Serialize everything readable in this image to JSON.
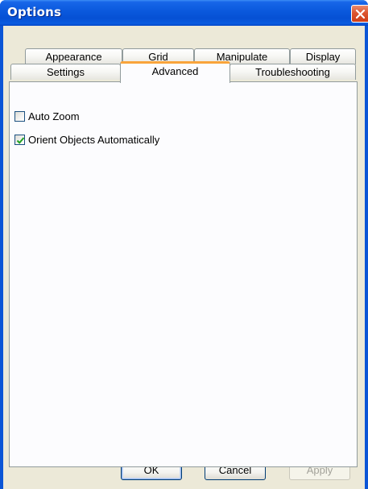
{
  "window": {
    "title": "Options"
  },
  "tabs": {
    "row1": [
      "Appearance",
      "Grid",
      "Manipulate",
      "Display"
    ],
    "row2": [
      "Settings",
      "Advanced",
      "Troubleshooting"
    ],
    "active": "Advanced"
  },
  "options": [
    {
      "label": "Auto Zoom",
      "checked": false
    },
    {
      "label": "Orient Objects Automatically",
      "checked": true
    }
  ],
  "buttons": {
    "ok": "OK",
    "cancel": "Cancel",
    "apply": "Apply",
    "apply_enabled": false
  },
  "colors": {
    "titlebar": "#0a58dc",
    "client_bg": "#ece9d8",
    "panel_bg": "#fcfcfe",
    "active_tab_accent": "#f9a43b",
    "close_button": "#dc5530",
    "check_mark": "#21a121"
  },
  "icons": {
    "close": "close-icon",
    "check": "checkmark-icon"
  }
}
